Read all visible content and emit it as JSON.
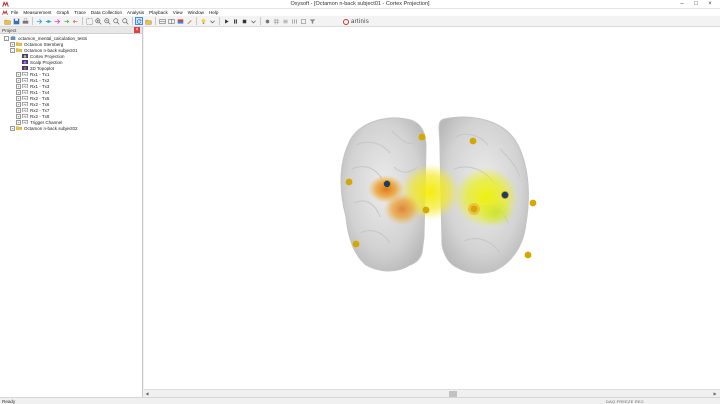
{
  "window": {
    "title": "Oxysoft - [Octamon n-back subject01 - Cortex Projection]"
  },
  "menu": [
    "File",
    "Measurement",
    "Graph",
    "Trace",
    "Data Collection",
    "Analysis",
    "Playback",
    "View",
    "Window",
    "Help"
  ],
  "brand": {
    "name": "artinis",
    "accent": "#c0392b"
  },
  "project_panel": {
    "title": "Project",
    "tree": [
      {
        "label": "octamon_mental_calculation_tests",
        "level": 0,
        "icon": "database-icon",
        "expander": "-"
      },
      {
        "label": "Octamon Sternberg",
        "level": 1,
        "icon": "folder-icon",
        "expander": "+"
      },
      {
        "label": "Octamon n-back subject01",
        "level": 1,
        "icon": "folder-icon",
        "expander": "-"
      },
      {
        "label": "Cortex Projection",
        "level": 2,
        "icon": "cortex-icon",
        "expander": ""
      },
      {
        "label": "Scalp Projection",
        "level": 2,
        "icon": "scalp-icon",
        "expander": ""
      },
      {
        "label": "2D Topoplot",
        "level": 2,
        "icon": "topoplot-icon",
        "expander": ""
      },
      {
        "label": "Rx1 - Tx1",
        "level": 2,
        "icon": "channel-icon",
        "expander": "+"
      },
      {
        "label": "Rx1 - Tx2",
        "level": 2,
        "icon": "channel-icon",
        "expander": "+"
      },
      {
        "label": "Rx1 - Tx3",
        "level": 2,
        "icon": "channel-icon",
        "expander": "+"
      },
      {
        "label": "Rx1 - Tx4",
        "level": 2,
        "icon": "channel-icon",
        "expander": "+"
      },
      {
        "label": "Rx2 - Tx5",
        "level": 2,
        "icon": "channel-icon",
        "expander": "+"
      },
      {
        "label": "Rx2 - Tx6",
        "level": 2,
        "icon": "channel-icon",
        "expander": "+"
      },
      {
        "label": "Rx2 - Tx7",
        "level": 2,
        "icon": "channel-icon",
        "expander": "+"
      },
      {
        "label": "Rx2 - Tx8",
        "level": 2,
        "icon": "channel-icon",
        "expander": "+"
      },
      {
        "label": "Trigger Channel",
        "level": 2,
        "icon": "channel-icon",
        "expander": "+"
      },
      {
        "label": "Octamon n-back subject02",
        "level": 1,
        "icon": "folder-icon",
        "expander": "+"
      }
    ]
  },
  "status": {
    "left": "Ready",
    "right": "DAQ  FREEZE  REC"
  },
  "colors": {
    "optode_transmitter": "#d4a800",
    "optode_receiver": "#1c3b6e",
    "activation_high": "#e07a10",
    "activation_mid": "#f3e400",
    "brain": "#d6d6d6",
    "selected_tool": "#cde8ff"
  }
}
